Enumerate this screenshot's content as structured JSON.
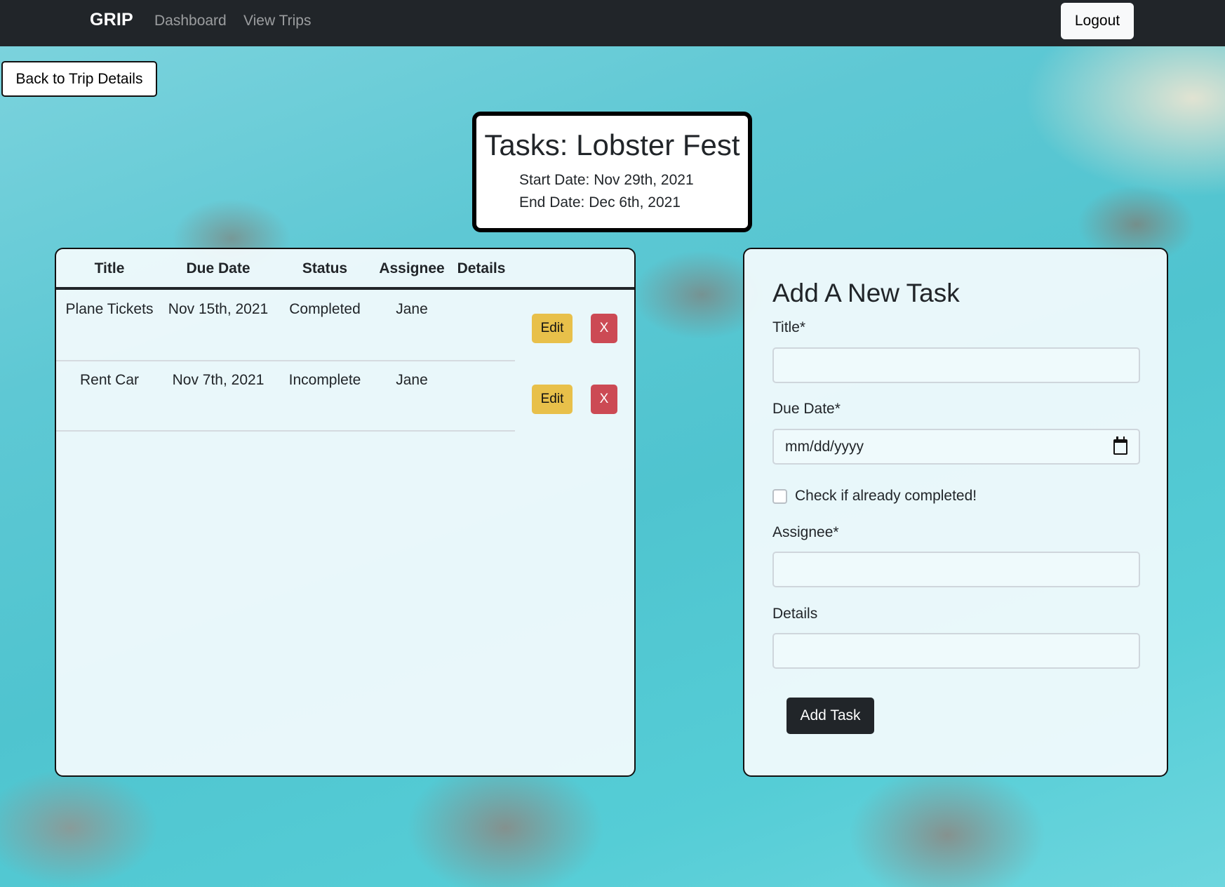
{
  "navbar": {
    "brand": "GRIP",
    "links": [
      "Dashboard",
      "View Trips"
    ],
    "logout_label": "Logout"
  },
  "back_button_label": "Back to Trip Details",
  "trip": {
    "heading": "Tasks: Lobster Fest",
    "start_date": "Start Date: Nov 29th, 2021",
    "end_date": "End Date: Dec 6th, 2021"
  },
  "tasks_table": {
    "columns": [
      "Title",
      "Due Date",
      "Status",
      "Assignee",
      "Details"
    ],
    "rows": [
      {
        "title": "Plane Tickets",
        "due_date": "Nov 15th, 2021",
        "status": "Completed",
        "assignee": "Jane",
        "details": "",
        "edit_label": "Edit",
        "delete_label": "X"
      },
      {
        "title": "Rent Car",
        "due_date": "Nov 7th, 2021",
        "status": "Incomplete",
        "assignee": "Jane",
        "details": "",
        "edit_label": "Edit",
        "delete_label": "X"
      }
    ]
  },
  "new_task_form": {
    "heading": "Add A New Task",
    "title_label": "Title*",
    "title_value": "",
    "due_date_label": "Due Date*",
    "due_date_placeholder": "mm/dd/yyyy",
    "completed_label": "Check if already completed!",
    "completed_checked": false,
    "assignee_label": "Assignee*",
    "assignee_value": "",
    "details_label": "Details",
    "details_value": "",
    "submit_label": "Add Task"
  },
  "colors": {
    "navbar_bg": "#212529",
    "edit_button": "#e8c04a",
    "delete_button": "#cc4a54",
    "submit_button": "#212529"
  }
}
